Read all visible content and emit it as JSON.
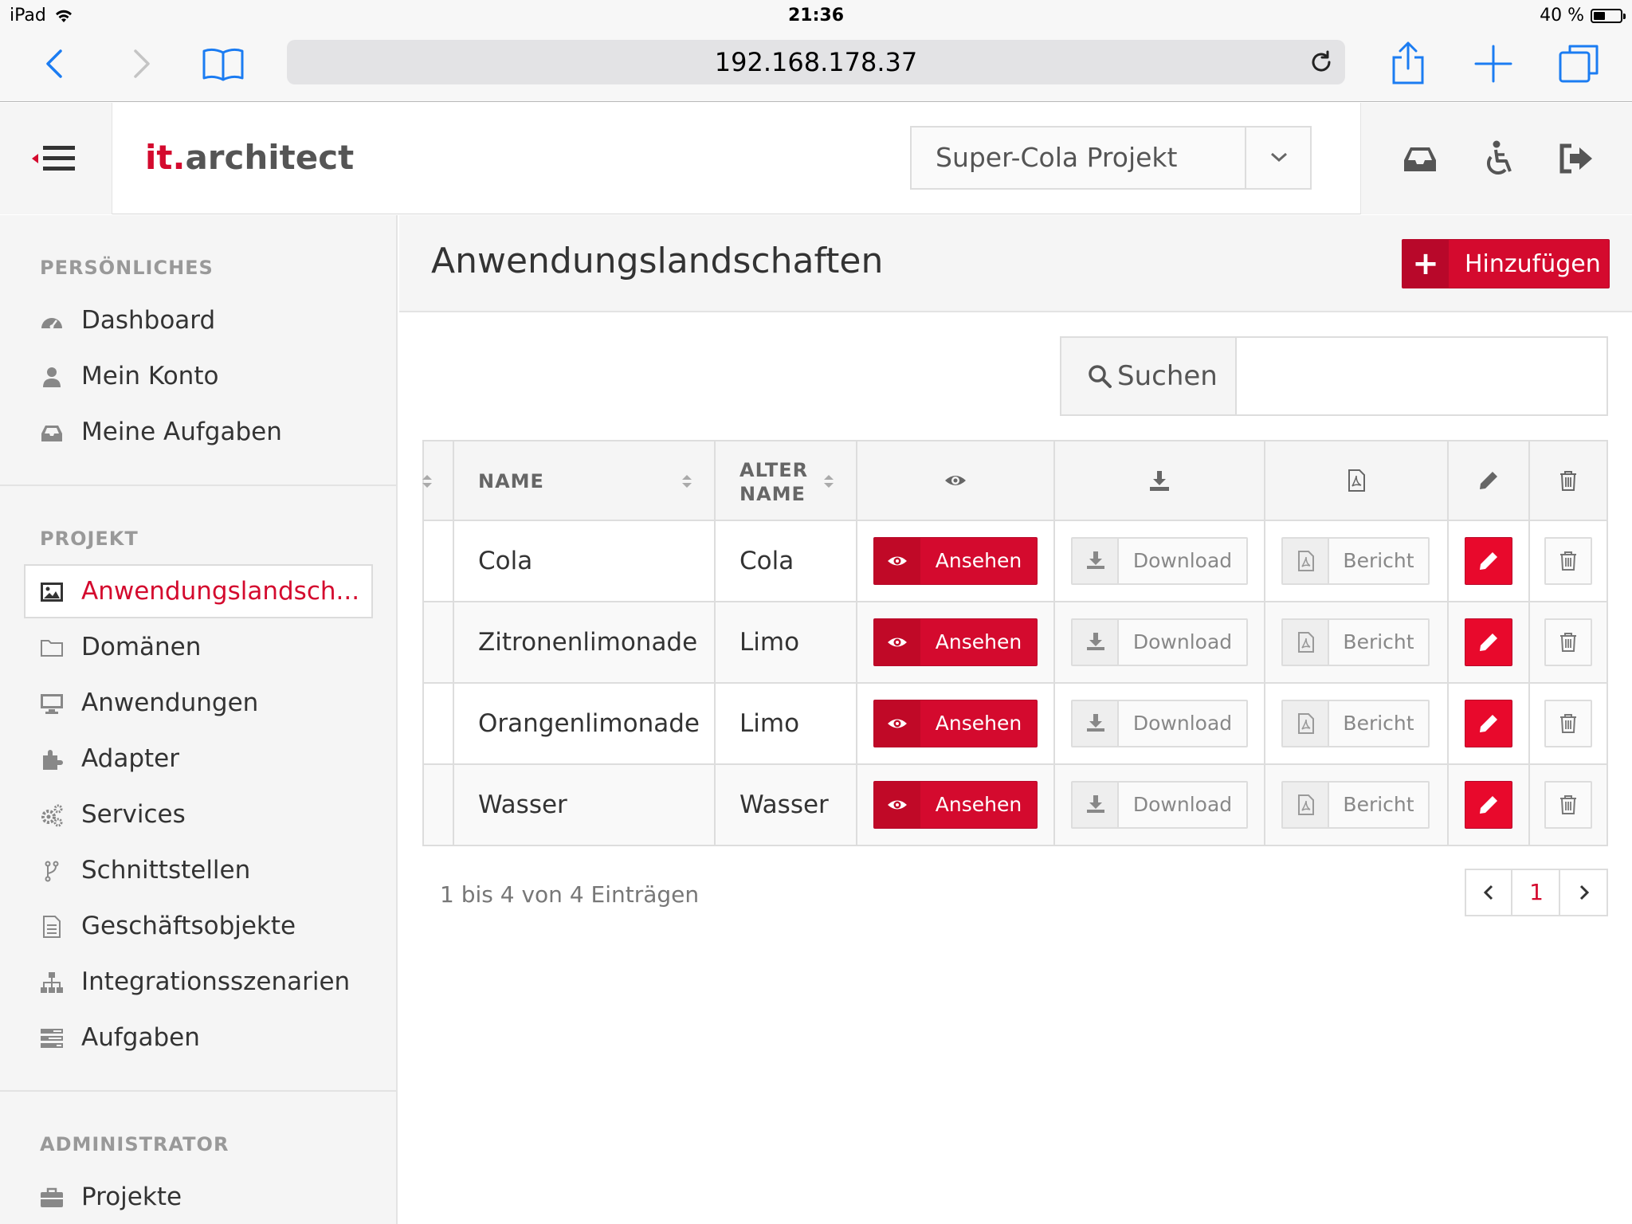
{
  "status": {
    "device": "iPad",
    "time": "21:36",
    "battery": "40 %",
    "battery_level": 0.4
  },
  "browser": {
    "url": "192.168.178.37"
  },
  "header": {
    "brand_prefix": "it.",
    "brand_name": "architect",
    "project": "Super-Cola Projekt"
  },
  "sidebar": {
    "personal_title": "PERSÖNLICHES",
    "personal": [
      {
        "label": "Dashboard",
        "icon": "dashboard-icon"
      },
      {
        "label": "Mein Konto",
        "icon": "user-icon"
      },
      {
        "label": "Meine Aufgaben",
        "icon": "inbox-icon"
      }
    ],
    "project_title": "PROJEKT",
    "project": [
      {
        "label": "Anwendungslandsch...",
        "icon": "image-icon",
        "active": true
      },
      {
        "label": "Domänen",
        "icon": "folder-icon"
      },
      {
        "label": "Anwendungen",
        "icon": "desktop-icon"
      },
      {
        "label": "Adapter",
        "icon": "puzzle-icon"
      },
      {
        "label": "Services",
        "icon": "gears-icon"
      },
      {
        "label": "Schnittstellen",
        "icon": "branch-icon"
      },
      {
        "label": "Geschäftsobjekte",
        "icon": "document-icon"
      },
      {
        "label": "Integrationsszenarien",
        "icon": "sitemap-icon"
      },
      {
        "label": "Aufgaben",
        "icon": "tasks-icon"
      }
    ],
    "admin_title": "ADMINISTRATOR",
    "admin": [
      {
        "label": "Projekte",
        "icon": "briefcase-icon"
      }
    ]
  },
  "main": {
    "title": "Anwendungslandschaften",
    "add_label": "Hinzufügen",
    "search_label": "Suchen",
    "search_value": "",
    "columns": {
      "name": "NAME",
      "alt_name_1": "ALTER",
      "alt_name_2": "NAME"
    },
    "rows": [
      {
        "name": "Cola",
        "alt": "Cola"
      },
      {
        "name": "Zitronenlimonade",
        "alt": "Limo"
      },
      {
        "name": "Orangenlimonade",
        "alt": "Limo"
      },
      {
        "name": "Wasser",
        "alt": "Wasser"
      }
    ],
    "view_label": "Ansehen",
    "download_label": "Download",
    "report_label": "Bericht",
    "info": "1 bis 4 von 4 Einträgen",
    "current_page": "1"
  },
  "colors": {
    "accent": "#d40a2e",
    "edit": "#e8092c"
  }
}
